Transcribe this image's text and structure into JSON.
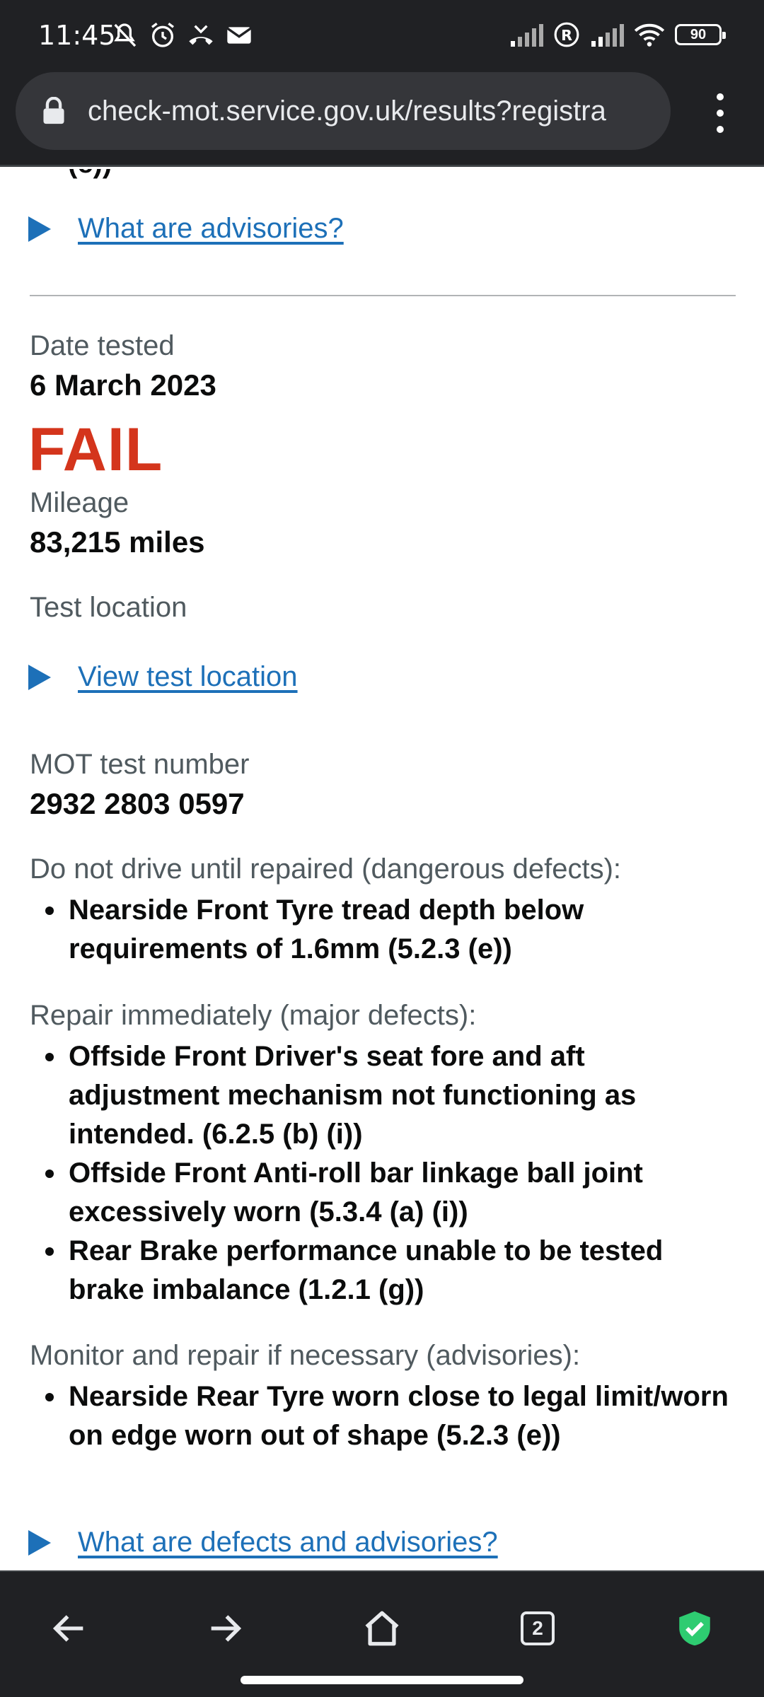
{
  "status_bar": {
    "time": "11:45",
    "battery": "90",
    "icons": [
      "mute-icon",
      "alarm-icon",
      "missed-call-icon",
      "mail-icon",
      "signal-icon",
      "roaming-icon",
      "signal-icon",
      "wifi-icon",
      "battery-icon"
    ]
  },
  "browser": {
    "url": "check-mot.service.gov.uk/results?registra",
    "menu_icon": "more-vert-icon",
    "lock_icon": "lock-icon"
  },
  "page": {
    "cut_text": "(e))",
    "advisories_link": "What are advisories?",
    "date_label": "Date tested",
    "date_value": "6 March 2023",
    "result": "FAIL",
    "result_color": "#d4351c",
    "mileage_label": "Mileage",
    "mileage_value": "83,215 miles",
    "location_label": "Test location",
    "location_link": "View test location",
    "test_number_label": "MOT test number",
    "test_number_value": "2932 2803 0597",
    "dangerous_heading": "Do not drive until repaired (dangerous defects):",
    "dangerous_items": [
      "Nearside Front Tyre tread depth below requirements of 1.6mm (5.2.3 (e))"
    ],
    "major_heading": "Repair immediately (major defects):",
    "major_items": [
      "Offside Front Driver's seat fore and aft adjustment mechanism not functioning as intended. (6.2.5 (b) (i))",
      "Offside Front Anti-roll bar linkage ball joint excessively worn (5.3.4 (a) (i))",
      "Rear Brake performance unable to be tested brake imbalance (1.2.1 (g))"
    ],
    "advisory_heading": "Monitor and repair if necessary (advisories):",
    "advisory_items": [
      "Nearside Rear Tyre worn close to legal limit/worn on edge worn out of shape (5.2.3 (e))"
    ],
    "defects_link": "What are defects and advisories?",
    "link_color": "#1d70b8"
  },
  "toolbar": {
    "tab_count": "2",
    "buttons": [
      "back-icon",
      "forward-icon",
      "home-icon",
      "tabs-icon",
      "shield-check-icon"
    ]
  }
}
